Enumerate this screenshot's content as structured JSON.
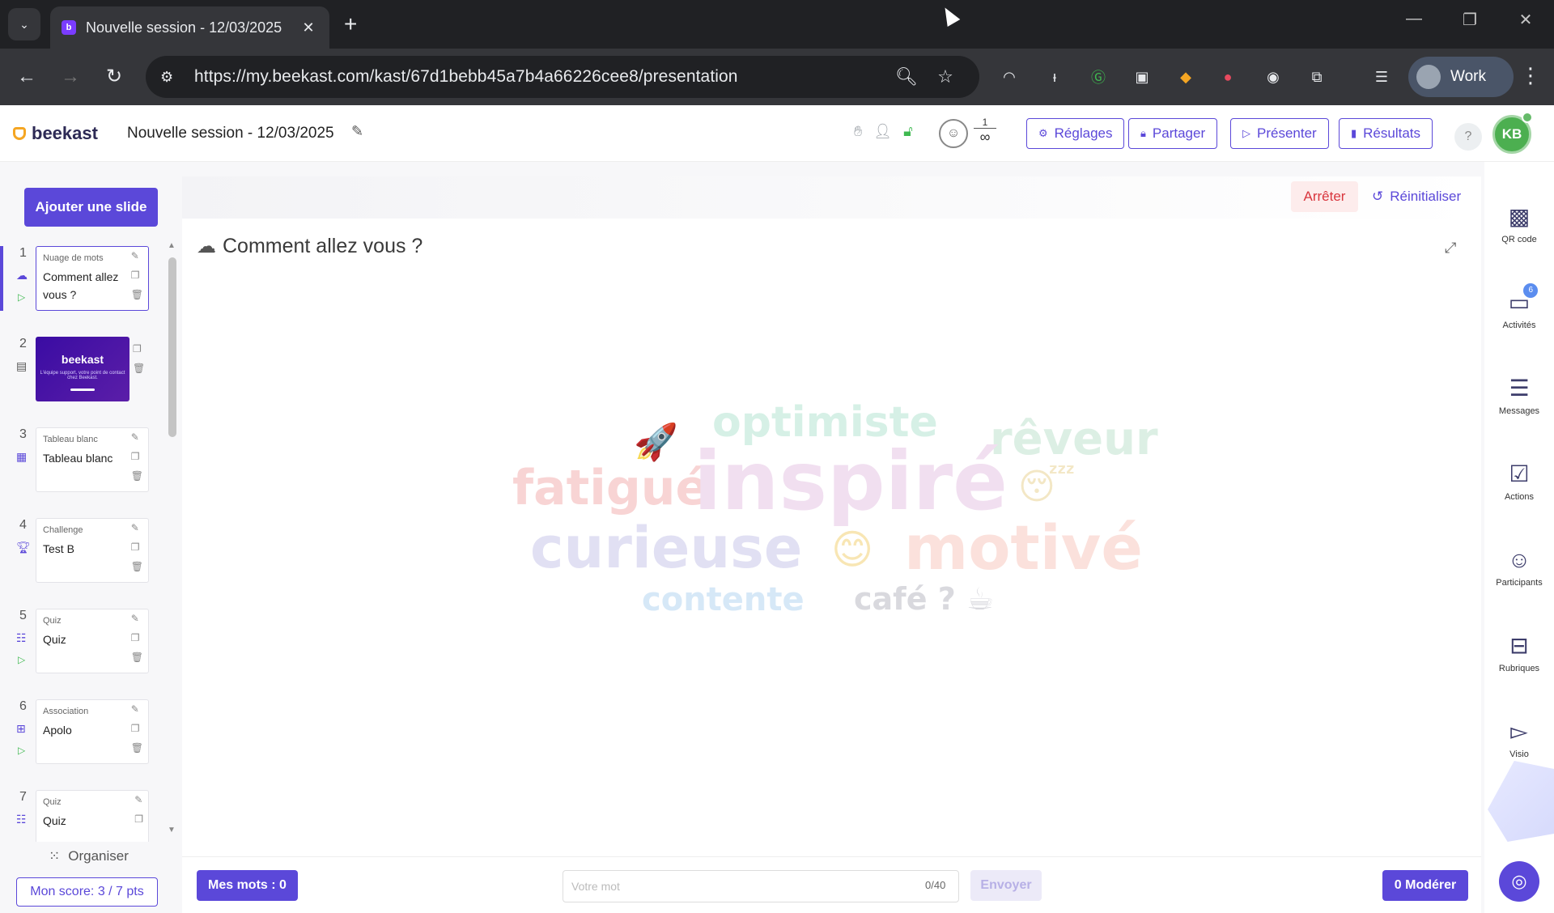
{
  "browser": {
    "tab_title": "Nouvelle session - 12/03/2025",
    "url": "https://my.beekast.com/kast/67d1bebb45a7b4a66226cee8/presentation",
    "profile_label": "Work"
  },
  "header": {
    "logo": "beekast",
    "session_title": "Nouvelle session - 12/03/2025",
    "participants_top": "1",
    "participants_bottom": "∞",
    "buttons": {
      "settings": "Réglages",
      "share": "Partager",
      "present": "Présenter",
      "results": "Résultats"
    },
    "help": "?",
    "avatar_initials": "KB"
  },
  "sidebar": {
    "add_slide": "Ajouter une slide",
    "slides": [
      {
        "num": "1",
        "kind": "Nuage de mots",
        "name": "Comment allez vous ?"
      },
      {
        "num": "2",
        "thumb_logo": "beekast",
        "thumb_sub": "L'équipe support, votre point de contact chez Beekast."
      },
      {
        "num": "3",
        "kind": "Tableau blanc",
        "name": "Tableau blanc"
      },
      {
        "num": "4",
        "kind": "Challenge",
        "name": "Test B"
      },
      {
        "num": "5",
        "kind": "Quiz",
        "name": "Quiz"
      },
      {
        "num": "6",
        "kind": "Association",
        "name": "Apolo"
      },
      {
        "num": "7",
        "kind": "Quiz",
        "name": "Quiz"
      }
    ],
    "organise": "Organiser",
    "score": "Mon score: 3 / 7 pts"
  },
  "stage": {
    "stop": "Arrêter",
    "reset": "Réinitialiser",
    "question": "Comment allez vous ?",
    "words": [
      {
        "text": "🚀",
        "color": "#f4d6cf"
      },
      {
        "text": "optimiste",
        "color": "#d6f0e6"
      },
      {
        "text": "rêveur",
        "color": "#dcefe4"
      },
      {
        "text": "fatigué",
        "color": "#f8d4d4"
      },
      {
        "text": "inspiré",
        "color": "#f1dff0"
      },
      {
        "text": "😴",
        "color": "#f3e7c5"
      },
      {
        "text": "curieuse",
        "color": "#e1e0f3"
      },
      {
        "text": "😊",
        "color": "#f8e6b4"
      },
      {
        "text": "motivé",
        "color": "#fbe1dc"
      },
      {
        "text": "contente",
        "color": "#d6e8f7"
      },
      {
        "text": "café ? ☕",
        "color": "#d9d9de"
      }
    ]
  },
  "bottom": {
    "my_words": "Mes mots : 0",
    "input_placeholder": "Votre mot",
    "char_count": "0/40",
    "send": "Envoyer",
    "moderate": "0 Modérer"
  },
  "rail": [
    {
      "label": "QR code",
      "icon": "qr-code-icon"
    },
    {
      "label": "Activités",
      "icon": "activities-icon",
      "badge": "6"
    },
    {
      "label": "Messages",
      "icon": "messages-icon"
    },
    {
      "label": "Actions",
      "icon": "actions-icon"
    },
    {
      "label": "Participants",
      "icon": "participants-icon"
    },
    {
      "label": "Rubriques",
      "icon": "rubriques-icon"
    },
    {
      "label": "Visio",
      "icon": "visio-icon"
    }
  ]
}
